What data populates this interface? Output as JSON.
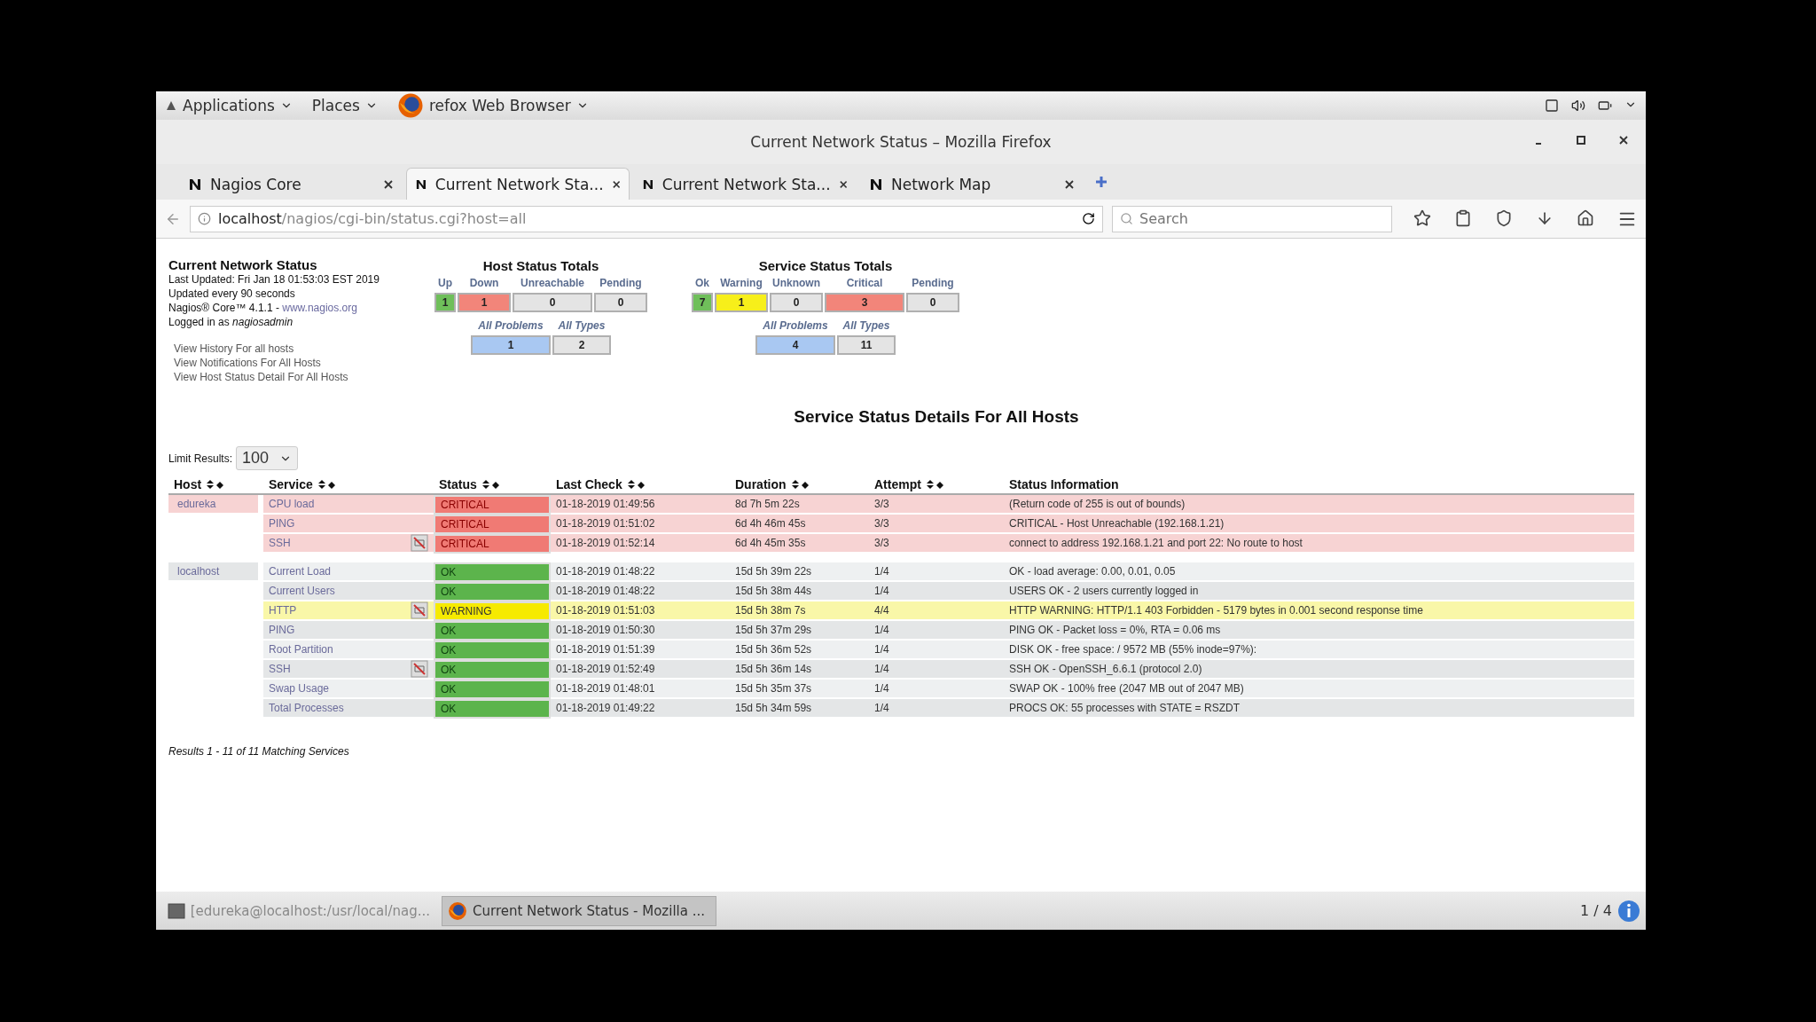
{
  "desktop_bar": {
    "menus": [
      {
        "label": "Applications",
        "kind": "apps"
      },
      {
        "label": "Places",
        "kind": "plain"
      },
      {
        "label": "refox Web Browser",
        "kind": "browser"
      }
    ]
  },
  "window": {
    "title": "Current Network Status – Mozilla Firefox"
  },
  "tabs": [
    {
      "label": "Nagios Core",
      "selected": false
    },
    {
      "label": "Current Network Sta...",
      "selected": true
    },
    {
      "label": "Current Network Sta...",
      "selected": false
    },
    {
      "label": "Network Map",
      "selected": false
    }
  ],
  "address_bar": {
    "host": "localhost",
    "path": "/nagios/cgi-bin/status.cgi?host=all"
  },
  "search": {
    "placeholder": "Search"
  },
  "info": {
    "title": "Current Network Status",
    "last_updated": "Last Updated: Fri Jan 18 01:53:03 EST 2019",
    "interval": "Updated every 90 seconds",
    "version": "Nagios® Core™ 4.1.1 - ",
    "version_link": "www.nagios.org",
    "login": "Logged in as *nagiosadmin*",
    "links": [
      "View History For all hosts",
      "View Notifications For All Hosts",
      "View Host Status Detail For All Hosts"
    ]
  },
  "host_totals": {
    "title": "Host Status Totals",
    "counts": [
      {
        "label": "Up",
        "value": "1",
        "color": "#6fbf5a"
      },
      {
        "label": "Down",
        "value": "1",
        "color": "#f2857a"
      },
      {
        "label": "Unreachable",
        "value": "0",
        "color": "#e4e4e4"
      },
      {
        "label": "Pending",
        "value": "0",
        "color": "#e4e4e4"
      }
    ],
    "summary": [
      {
        "label": "All Problems",
        "value": "1",
        "color": "#a9c8f2"
      },
      {
        "label": "All Types",
        "value": "2",
        "color": "#e4e4e4"
      }
    ]
  },
  "service_totals": {
    "title": "Service Status Totals",
    "counts": [
      {
        "label": "Ok",
        "value": "7",
        "color": "#6fbf5a"
      },
      {
        "label": "Warning",
        "value": "1",
        "color": "#f7ef1a"
      },
      {
        "label": "Unknown",
        "value": "0",
        "color": "#e4e4e4"
      },
      {
        "label": "Critical",
        "value": "3",
        "color": "#f2857a"
      },
      {
        "label": "Pending",
        "value": "0",
        "color": "#e4e4e4"
      }
    ],
    "summary": [
      {
        "label": "All Problems",
        "value": "4",
        "color": "#a9c8f2"
      },
      {
        "label": "All Types",
        "value": "11",
        "color": "#e4e4e4"
      }
    ]
  },
  "heading": "Service Status Details For All Hosts",
  "limit": {
    "label": "Limit Results:",
    "value": "100"
  },
  "table": {
    "columns": [
      {
        "label": "Host",
        "sortable": true
      },
      {
        "label": "Service",
        "sortable": true
      },
      {
        "label": "Status",
        "sortable": true
      },
      {
        "label": "Last Check",
        "sortable": true
      },
      {
        "label": "Duration",
        "sortable": true
      },
      {
        "label": "Attempt",
        "sortable": true
      },
      {
        "label": "Status Information",
        "sortable": false
      }
    ],
    "hosts": [
      {
        "name": "edureka",
        "kind": "down",
        "services": [
          {
            "service": "CPU load",
            "notifications_disabled": false,
            "kind": "critical",
            "status": "CRITICAL",
            "last_check": "01-18-2019 01:49:56",
            "duration": "8d 7h 5m 22s",
            "attempt": "3/3",
            "info": "(Return code of 255 is out of bounds)"
          },
          {
            "service": "PING",
            "notifications_disabled": false,
            "kind": "critical",
            "status": "CRITICAL",
            "last_check": "01-18-2019 01:51:02",
            "duration": "6d 4h 46m 45s",
            "attempt": "3/3",
            "info": "CRITICAL - Host Unreachable (192.168.1.21)"
          },
          {
            "service": "SSH",
            "notifications_disabled": true,
            "kind": "critical",
            "status": "CRITICAL",
            "last_check": "01-18-2019 01:52:14",
            "duration": "6d 4h 45m 35s",
            "attempt": "3/3",
            "info": "connect to address 192.168.1.21 and port 22: No route to host"
          }
        ]
      },
      {
        "name": "localhost",
        "kind": "up",
        "services": [
          {
            "service": "Current Load",
            "notifications_disabled": false,
            "kind": "ok",
            "status": "OK",
            "last_check": "01-18-2019 01:48:22",
            "duration": "15d 5h 39m 22s",
            "attempt": "1/4",
            "info": "OK - load average: 0.00, 0.01, 0.05"
          },
          {
            "service": "Current Users",
            "notifications_disabled": false,
            "kind": "ok",
            "status": "OK",
            "last_check": "01-18-2019 01:48:22",
            "duration": "15d 5h 38m 44s",
            "attempt": "1/4",
            "info": "USERS OK - 2 users currently logged in"
          },
          {
            "service": "HTTP",
            "notifications_disabled": true,
            "kind": "warning",
            "status": "WARNING",
            "last_check": "01-18-2019 01:51:03",
            "duration": "15d 5h 38m 7s",
            "attempt": "4/4",
            "info": "HTTP WARNING: HTTP/1.1 403 Forbidden - 5179 bytes in 0.001 second response time"
          },
          {
            "service": "PING",
            "notifications_disabled": false,
            "kind": "ok",
            "status": "OK",
            "last_check": "01-18-2019 01:50:30",
            "duration": "15d 5h 37m 29s",
            "attempt": "1/4",
            "info": "PING OK - Packet loss = 0%, RTA = 0.06 ms"
          },
          {
            "service": "Root Partition",
            "notifications_disabled": false,
            "kind": "ok",
            "status": "OK",
            "last_check": "01-18-2019 01:51:39",
            "duration": "15d 5h 36m 52s",
            "attempt": "1/4",
            "info": "DISK OK - free space: / 9572 MB (55% inode=97%):"
          },
          {
            "service": "SSH",
            "notifications_disabled": true,
            "kind": "ok",
            "status": "OK",
            "last_check": "01-18-2019 01:52:49",
            "duration": "15d 5h 36m 14s",
            "attempt": "1/4",
            "info": "SSH OK - OpenSSH_6.6.1 (protocol 2.0)"
          },
          {
            "service": "Swap Usage",
            "notifications_disabled": false,
            "kind": "ok",
            "status": "OK",
            "last_check": "01-18-2019 01:48:01",
            "duration": "15d 5h 35m 37s",
            "attempt": "1/4",
            "info": "SWAP OK - 100% free (2047 MB out of 2047 MB)"
          },
          {
            "service": "Total Processes",
            "notifications_disabled": false,
            "kind": "ok",
            "status": "OK",
            "last_check": "01-18-2019 01:49:22",
            "duration": "15d 5h 34m 59s",
            "attempt": "1/4",
            "info": "PROCS OK: 55 processes with STATE = RSZDT"
          }
        ]
      }
    ]
  },
  "results": "Results 1 - 11 of 11 Matching Services",
  "taskbar": {
    "items": [
      {
        "label": "[edureka@localhost:/usr/local/nag...",
        "kind": "terminal",
        "selected": false
      },
      {
        "label": "Current Network Status - Mozilla ...",
        "kind": "browser",
        "selected": true
      }
    ],
    "pager": "1 / 4"
  }
}
